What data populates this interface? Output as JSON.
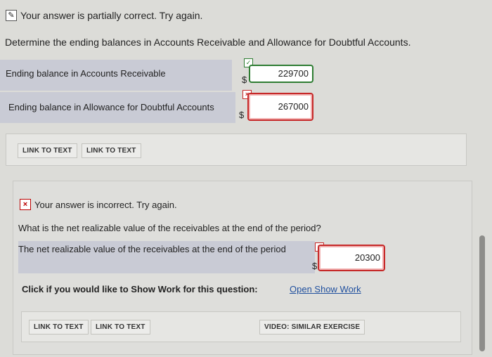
{
  "part1": {
    "status": "Your answer is partially correct.  Try again.",
    "question": "Determine the ending balances in Accounts Receivable and Allowance for Doubtful Accounts.",
    "rows": [
      {
        "label": "Ending balance in Accounts Receivable",
        "currency": "$",
        "value": "229700",
        "result": "correct"
      },
      {
        "label": "Ending balance in Allowance for Doubtful Accounts",
        "currency": "$",
        "value": "267000",
        "result": "incorrect"
      }
    ],
    "links": [
      "LINK TO TEXT",
      "LINK TO TEXT"
    ]
  },
  "part2": {
    "status": "Your answer is incorrect.  Try again.",
    "question": "What is the net realizable value of the receivables at the end of the period?",
    "row": {
      "label": "The net realizable value of the receivables at the end of the period",
      "currency": "$",
      "value": "20300",
      "result": "incorrect"
    },
    "show_work_prompt": "Click if you would like to Show Work for this question:",
    "show_work_link": "Open Show Work",
    "links": [
      "LINK TO TEXT",
      "LINK TO TEXT"
    ],
    "video": "VIDEO: SIMILAR EXERCISE"
  },
  "icons": {
    "edit": "pencil-icon",
    "check": "check-icon",
    "cross": "x-icon"
  }
}
